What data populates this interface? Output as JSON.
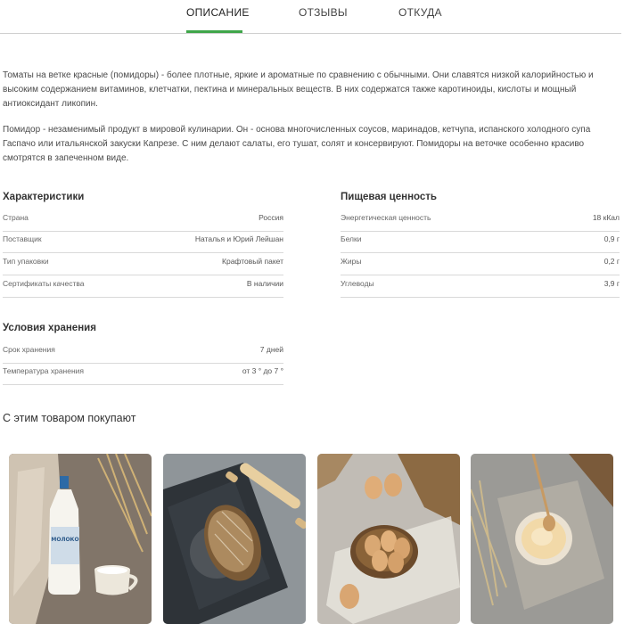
{
  "tabs": [
    {
      "label": "ОПИСАНИЕ",
      "active": true
    },
    {
      "label": "ОТЗЫВЫ",
      "active": false
    },
    {
      "label": "ОТКУДА",
      "active": false
    }
  ],
  "description": {
    "p1": "Томаты на ветке красные (помидоры) - более плотные, яркие и ароматные по сравнению с обычными. Они славятся низкой калорийностью и высоким содержанием витаминов, клетчатки, пектина и минеральных веществ. В них содержатся также каротиноиды, кислоты и мощный антиоксидант ликопин.",
    "p2": "Помидор - незаменимый продукт в мировой кулинарии. Он - основа многочисленных соусов, маринадов, кетчупа, испанского холодного супа Гаспачо или итальянской закуски Капрезе. С ним делают салаты, его тушат, солят и консервируют. Помидоры на веточке особенно красиво смотрятся в запеченном виде."
  },
  "characteristics": {
    "title": "Характеристики",
    "rows": [
      {
        "key": "Страна",
        "value": "Россия"
      },
      {
        "key": "Поставщик",
        "value": "Наталья и Юрий Лейшан"
      },
      {
        "key": "Тип упаковки",
        "value": "Крафтовый пакет"
      },
      {
        "key": "Сертификаты качества",
        "value": "В наличии"
      }
    ]
  },
  "nutrition": {
    "title": "Пищевая ценность",
    "rows": [
      {
        "key": "Энергетическая ценность",
        "value": "18 кКал"
      },
      {
        "key": "Белки",
        "value": "0,9 г"
      },
      {
        "key": "Жиры",
        "value": "0,2 г"
      },
      {
        "key": "Углеводы",
        "value": "3,9 г"
      }
    ]
  },
  "storage": {
    "title": "Условия хранения",
    "rows": [
      {
        "key": "Срок хранения",
        "value": "7 дней"
      },
      {
        "key": "Температура хранения",
        "value": "от 3 ° до 7 °"
      }
    ]
  },
  "related": {
    "title": "С этим товаром покупают",
    "products": [
      {
        "image": "milk-bottle-image",
        "label": "МОЛОКО"
      },
      {
        "image": "bread-loaf-image"
      },
      {
        "image": "eggs-basket-image"
      },
      {
        "image": "cream-bowl-image"
      }
    ]
  },
  "colors": {
    "accent": "#3fa64a",
    "divider": "#d9d9d9"
  }
}
